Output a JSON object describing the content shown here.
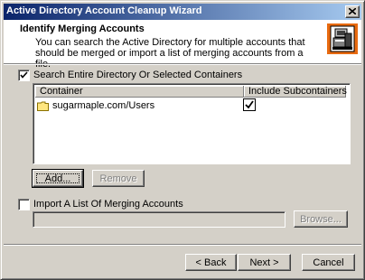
{
  "window": {
    "title": "Active Directory Account Cleanup Wizard"
  },
  "header": {
    "title": "Identify Merging Accounts",
    "description": "You can search the Active Directory for multiple accounts that should be merged or import a list of merging accounts from a file."
  },
  "search_option": {
    "label": "Search Entire Directory Or Selected Containers",
    "checked": true
  },
  "containers_list": {
    "columns": [
      "Container",
      "Include Subcontainers"
    ],
    "rows": [
      {
        "container": "sugarmaple.com/Users",
        "include_subcontainers": true
      }
    ]
  },
  "buttons": {
    "add": "Add...",
    "remove": "Remove",
    "browse": "Browse...",
    "back": "< Back",
    "next": "Next >",
    "cancel": "Cancel"
  },
  "import_option": {
    "label": "Import A List Of Merging Accounts",
    "checked": false,
    "file_value": ""
  },
  "icons": {
    "close": "close-icon",
    "wizard": "computer-wizard-icon",
    "folder": "folder-icon",
    "check": "checkmark-icon"
  }
}
